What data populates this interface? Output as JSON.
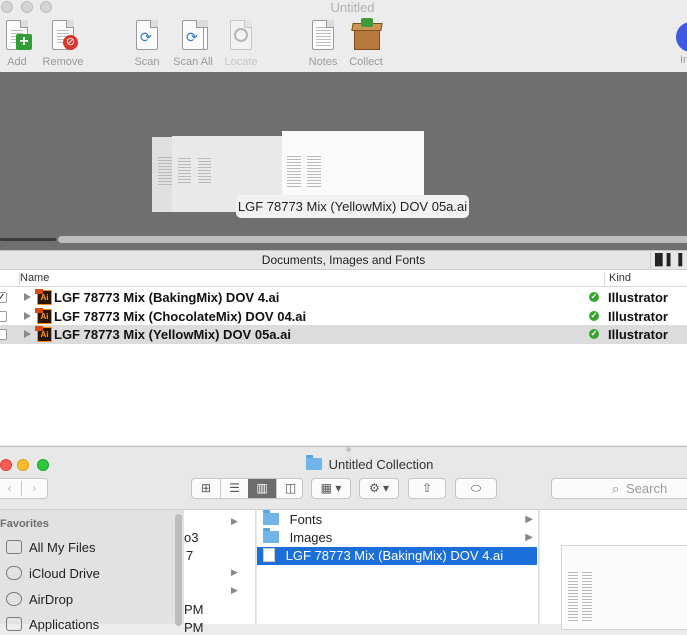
{
  "app": {
    "title": "Untitled",
    "toolbar": [
      {
        "label": "Add",
        "icon": "add-icon"
      },
      {
        "label": "Remove",
        "icon": "remove-icon"
      },
      {
        "label": "Scan",
        "icon": "scan-icon"
      },
      {
        "label": "Scan All",
        "icon": "scan-all-icon"
      },
      {
        "label": "Locate",
        "icon": "locate-icon"
      },
      {
        "label": "Notes",
        "icon": "notes-icon"
      },
      {
        "label": "Collect",
        "icon": "collect-icon"
      }
    ],
    "preview_tooltip": "LGF 78773 Mix (YellowMix) DOV 05a.ai",
    "list_header": "Documents, Images and Fonts",
    "columns": {
      "name": "Name",
      "kind": "Kind"
    },
    "rows": [
      {
        "name": "LGF 78773 Mix (BakingMix) DOV 4.ai",
        "kind": "Illustrator",
        "checked": true
      },
      {
        "name": "LGF 78773 Mix (ChocolateMix) DOV 04.ai",
        "kind": "Illustrator",
        "checked": false
      },
      {
        "name": "LGF 78773 Mix (YellowMix) DOV 05a.ai",
        "kind": "Illustrator",
        "checked": false
      }
    ],
    "check_mark": "✓"
  },
  "finder": {
    "title": "Untitled Collection",
    "search_placeholder": "Search",
    "sidebar_heading": "Favorites",
    "favorites": [
      "All My Files",
      "iCloud Drive",
      "AirDrop",
      "Applications"
    ],
    "col1_fragments": [
      "o3",
      "7",
      "PM",
      "PM"
    ],
    "items": [
      {
        "name": "Fonts",
        "type": "folder"
      },
      {
        "name": "Images",
        "type": "folder"
      },
      {
        "name": "LGF 78773 Mix (BakingMix) DOV 4.ai",
        "type": "file"
      }
    ]
  },
  "colors": {
    "selection": "#1a6fdb",
    "status_ok": "#37a631",
    "preview_bg": "#6f6f6f"
  }
}
